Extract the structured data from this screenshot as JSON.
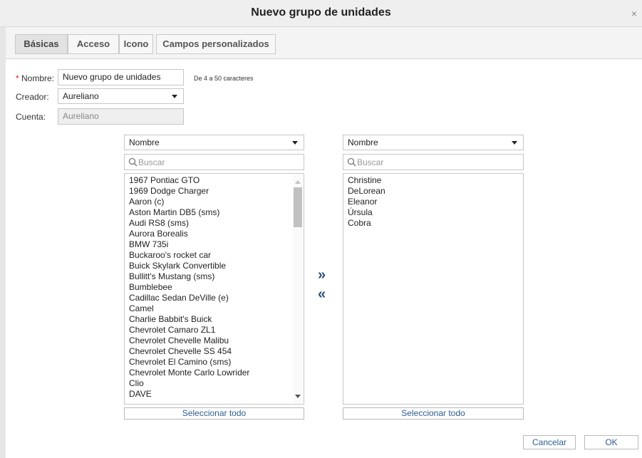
{
  "dialog": {
    "title": "Nuevo grupo de unidades",
    "close_symbol": "×"
  },
  "tabs": [
    {
      "label": "Básicas",
      "active": true
    },
    {
      "label": "Acceso",
      "active": false
    },
    {
      "label": "Icono",
      "active": false
    },
    {
      "label": "Campos personalizados",
      "active": false
    }
  ],
  "form": {
    "name_required_mark": "*",
    "name_label": " Nombre:",
    "name_value": "Nuevo grupo de unidades",
    "name_hint": "De 4 a 50 caracteres",
    "creator_label": "Creador:",
    "creator_value": "Aureliano",
    "account_label": "Cuenta:",
    "account_value": "Aureliano"
  },
  "left_panel": {
    "sort_value": "Nombre",
    "search_placeholder": "Buscar",
    "items": [
      "1967 Pontiac GTO",
      "1969 Dodge Charger",
      "Aaron (c)",
      "Aston Martin DB5 (sms)",
      "Audi RS8 (sms)",
      "Aurora Borealis",
      "BMW 735i",
      "Buckaroo's rocket car",
      "Buick Skylark Convertible",
      "Bullitt's Mustang (sms)",
      "Bumblebee",
      "Cadillac Sedan DeVille (e)",
      "Camel",
      "Charlie Babbit's Buick",
      "Chevrolet Camaro ZL1",
      "Chevrolet Chevelle Malibu",
      "Chevrolet Chevelle SS 454",
      "Chevrolet El Camino (sms)",
      "Chevrolet Monte Carlo Lowrider",
      "Clio",
      "DAVE"
    ],
    "select_all_label": "Seleccionar todo"
  },
  "transfer": {
    "add_symbol": "»",
    "remove_symbol": "«"
  },
  "right_panel": {
    "sort_value": "Nombre",
    "search_placeholder": "Buscar",
    "items": [
      "Christine",
      "DeLorean",
      "Eleanor",
      "Úrsula",
      "Cobra"
    ],
    "select_all_label": "Seleccionar todo"
  },
  "footer": {
    "cancel_label": "Cancelar",
    "ok_label": "OK"
  },
  "colors": {
    "accent_text": "#2a5d8f",
    "required_mark": "#e02020"
  }
}
